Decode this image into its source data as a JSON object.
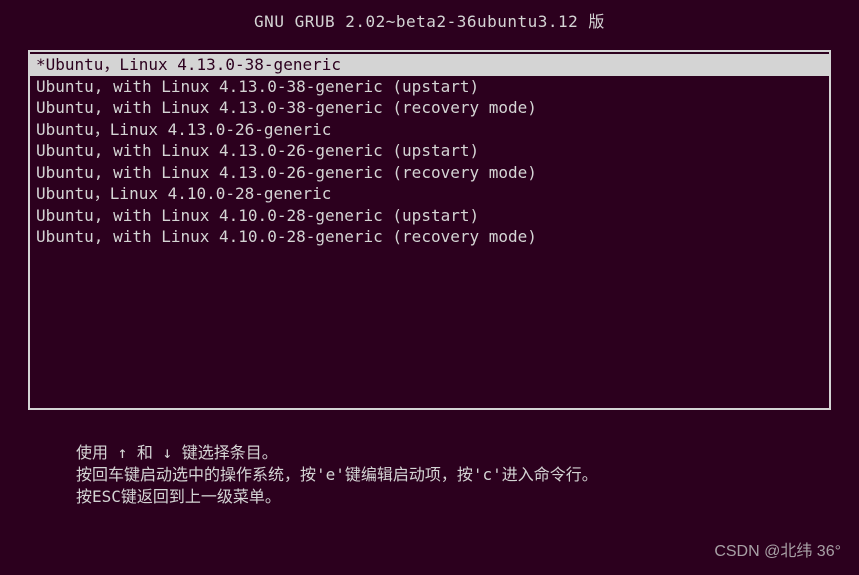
{
  "header": {
    "title": "GNU GRUB  2.02~beta2-36ubuntu3.12 版"
  },
  "menu": {
    "items": [
      {
        "label": "*Ubuntu，Linux 4.13.0-38-generic",
        "selected": true
      },
      {
        "label": " Ubuntu, with Linux 4.13.0-38-generic (upstart)",
        "selected": false
      },
      {
        "label": " Ubuntu, with Linux 4.13.0-38-generic (recovery mode)",
        "selected": false
      },
      {
        "label": " Ubuntu，Linux 4.13.0-26-generic",
        "selected": false
      },
      {
        "label": " Ubuntu, with Linux 4.13.0-26-generic (upstart)",
        "selected": false
      },
      {
        "label": " Ubuntu, with Linux 4.13.0-26-generic (recovery mode)",
        "selected": false
      },
      {
        "label": " Ubuntu，Linux 4.10.0-28-generic",
        "selected": false
      },
      {
        "label": " Ubuntu, with Linux 4.10.0-28-generic (upstart)",
        "selected": false
      },
      {
        "label": " Ubuntu, with Linux 4.10.0-28-generic (recovery mode)",
        "selected": false
      }
    ]
  },
  "help": {
    "line1": "使用 ↑ 和 ↓ 键选择条目。",
    "line2": "按回车键启动选中的操作系统，按'e'键编辑启动项，按'c'进入命令行。",
    "line3": "按ESC键返回到上一级菜单。"
  },
  "watermark": {
    "text": "CSDN @北纬  36°"
  }
}
